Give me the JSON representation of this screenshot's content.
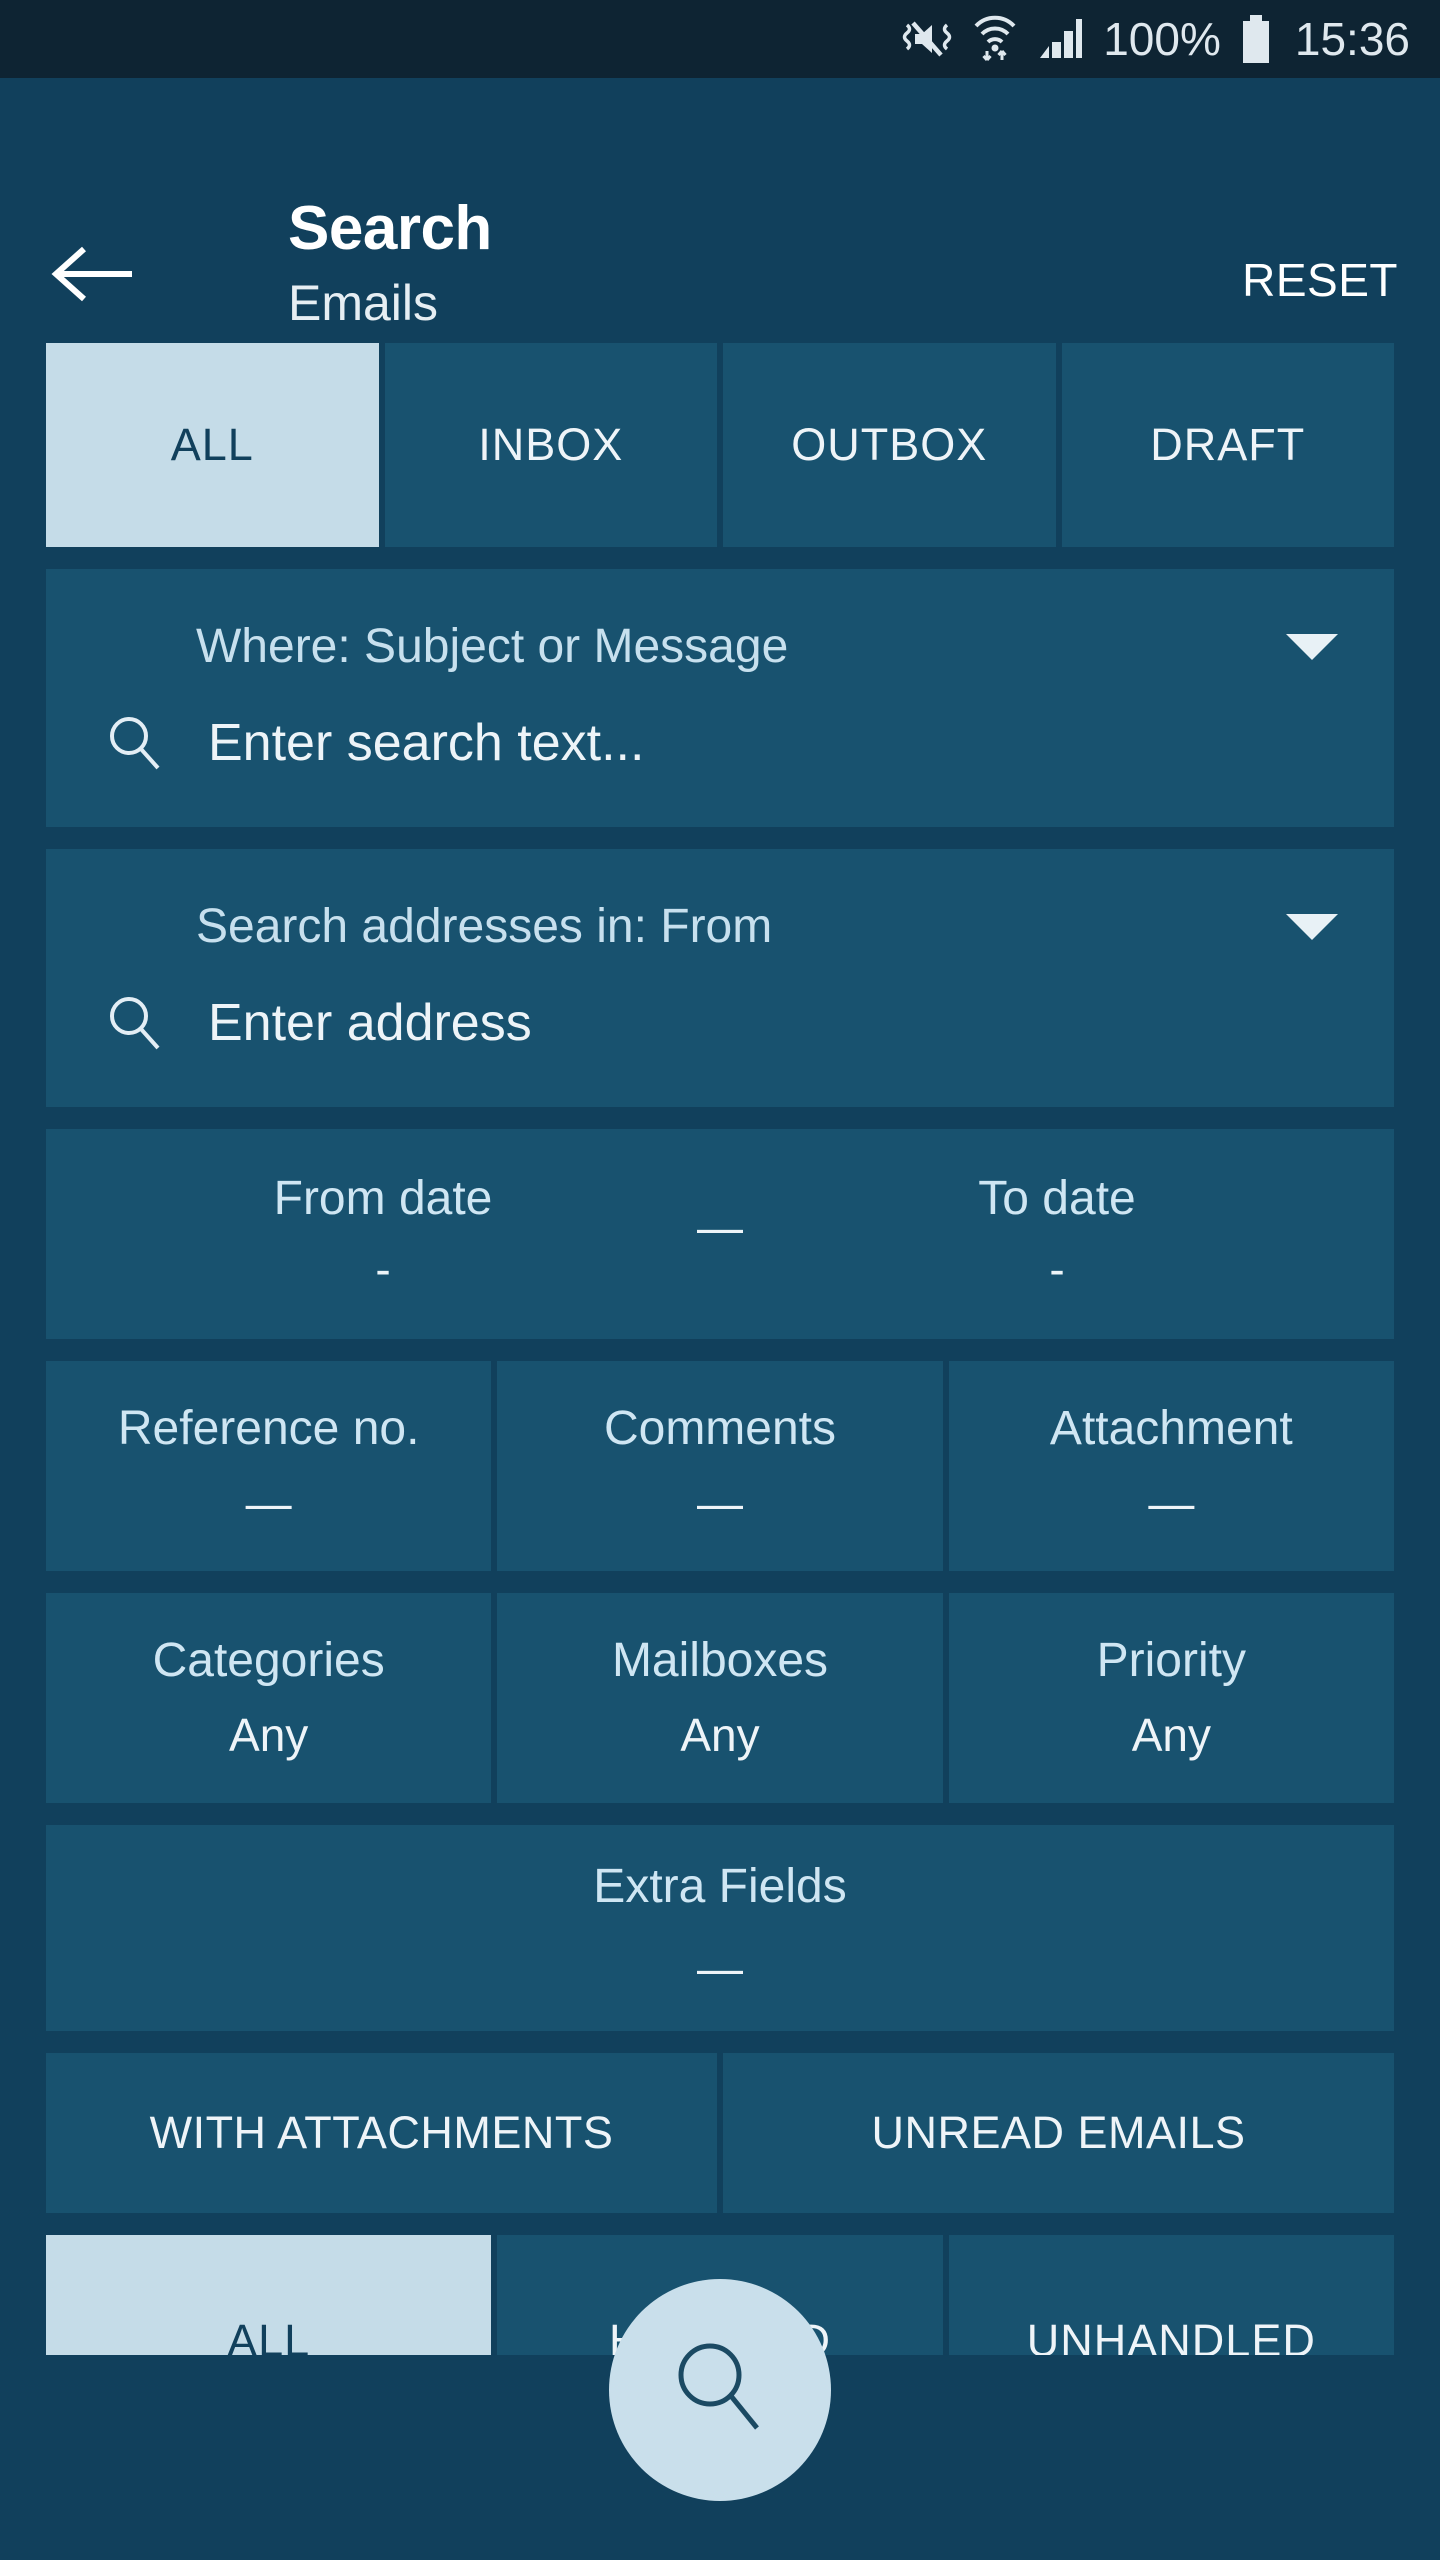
{
  "statusbar": {
    "icons": [
      "mute-vibrate-icon",
      "wifi-icon",
      "signal-icon",
      "battery-icon"
    ],
    "battery_percent": "100%",
    "clock": "15:36"
  },
  "appbar": {
    "back_icon": "back-arrow-icon",
    "title": "Search",
    "subtitle": "Emails",
    "reset_label": "RESET"
  },
  "tabs": [
    {
      "label": "ALL",
      "selected": true
    },
    {
      "label": "INBOX",
      "selected": false
    },
    {
      "label": "OUTBOX",
      "selected": false
    },
    {
      "label": "DRAFT",
      "selected": false
    }
  ],
  "text_search": {
    "scope_label": "Where: Subject or Message",
    "caret_icon": "chevron-down-icon",
    "search_icon": "search-icon",
    "placeholder": "Enter search text..."
  },
  "address_search": {
    "scope_label": "Search addresses in: From",
    "caret_icon": "chevron-down-icon",
    "search_icon": "search-icon",
    "placeholder": "Enter address"
  },
  "date_range": {
    "from_label": "From date",
    "from_value": "-",
    "separator": "—",
    "to_label": "To date",
    "to_value": "-"
  },
  "filters_row1": [
    {
      "label": "Reference no.",
      "value": "—"
    },
    {
      "label": "Comments",
      "value": "—"
    },
    {
      "label": "Attachment",
      "value": "—"
    }
  ],
  "filters_row2": [
    {
      "label": "Categories",
      "value": "Any"
    },
    {
      "label": "Mailboxes",
      "value": "Any"
    },
    {
      "label": "Priority",
      "value": "Any"
    }
  ],
  "extra_fields": {
    "label": "Extra Fields",
    "value": "—"
  },
  "toggles": [
    {
      "label": "WITH ATTACHMENTS"
    },
    {
      "label": "UNREAD EMAILS"
    }
  ],
  "bottom_tabs": [
    {
      "label": "ALL",
      "selected": true
    },
    {
      "label": "HANDLED",
      "selected": false
    },
    {
      "label": "UNHANDLED",
      "selected": false
    }
  ],
  "fab": {
    "icon": "search-icon"
  },
  "colors": {
    "statusbar_bg": "#0e2433",
    "page_bg": "#11405c",
    "card_bg": "#18526f",
    "accent_light": "#c5dce8",
    "text_primary": "#eef4f8",
    "text_label": "#cfe6f3"
  }
}
